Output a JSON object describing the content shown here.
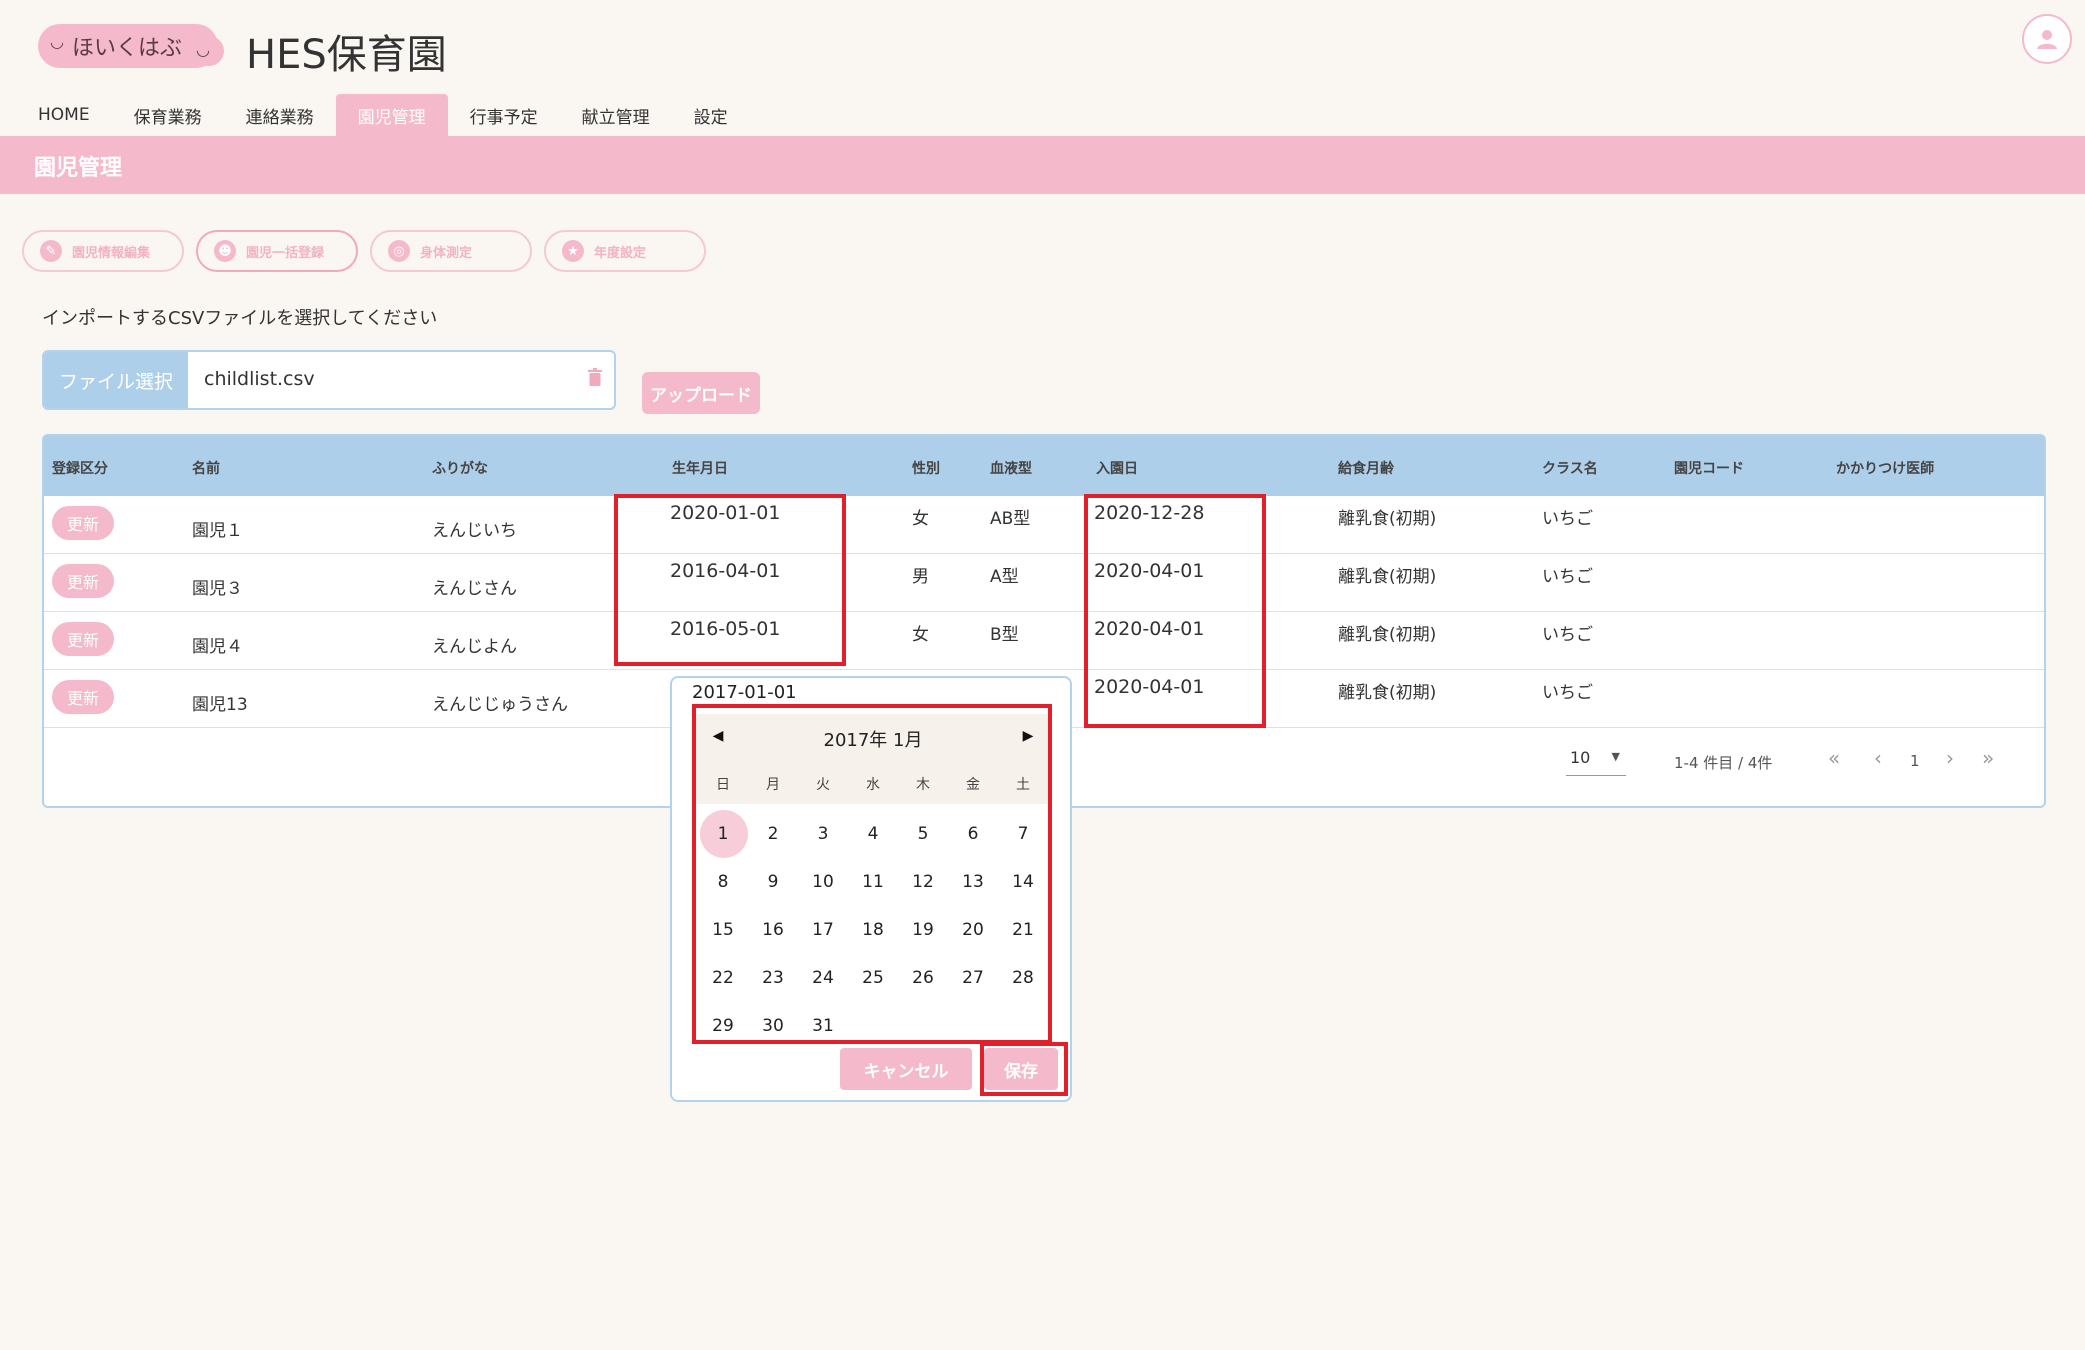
{
  "header": {
    "logo_text": "ほいくはぶ",
    "site_title": "HES保育園"
  },
  "nav": {
    "items": [
      {
        "label": "HOME"
      },
      {
        "label": "保育業務"
      },
      {
        "label": "連絡業務"
      },
      {
        "label": "園児管理"
      },
      {
        "label": "行事予定"
      },
      {
        "label": "献立管理"
      },
      {
        "label": "設定"
      }
    ],
    "active": "園児管理"
  },
  "section_title": "園児管理",
  "actions": [
    {
      "label": "園児情報編集",
      "icon": "edit-icon"
    },
    {
      "label": "園児一括登録",
      "icon": "group-icon"
    },
    {
      "label": "身体測定",
      "icon": "measure-icon"
    },
    {
      "label": "年度設定",
      "icon": "star-icon"
    }
  ],
  "import": {
    "label": "インポートするCSVファイルを選択してください",
    "file_button": "ファイル選択",
    "file_name": "childlist.csv",
    "upload_button": "アップロード"
  },
  "table": {
    "headers": [
      "登録区分",
      "名前",
      "ふりがな",
      "生年月日",
      "性別",
      "血液型",
      "入園日",
      "給食月齢",
      "クラス名",
      "園児コード",
      "かかりつけ医師"
    ],
    "rows": [
      {
        "status": "更新",
        "name": "園児１",
        "kana": "えんじいち",
        "birth": "2020-01-01",
        "sex": "女",
        "blood": "AB型",
        "entry": "2020-12-28",
        "meal": "離乳食(初期)",
        "class": "いちご"
      },
      {
        "status": "更新",
        "name": "園児３",
        "kana": "えんじさん",
        "birth": "2016-04-01",
        "sex": "男",
        "blood": "A型",
        "entry": "2020-04-01",
        "meal": "離乳食(初期)",
        "class": "いちご"
      },
      {
        "status": "更新",
        "name": "園児４",
        "kana": "えんじよん",
        "birth": "2016-05-01",
        "sex": "女",
        "blood": "B型",
        "entry": "2020-04-01",
        "meal": "離乳食(初期)",
        "class": "いちご"
      },
      {
        "status": "更新",
        "name": "園児13",
        "kana": "えんじじゅうさん",
        "birth": "",
        "sex": "",
        "blood": "",
        "entry": "2020-04-01",
        "meal": "離乳食(初期)",
        "class": "いちご"
      }
    ],
    "pager": {
      "per_page": "10",
      "range": "1-4 件目 / 4件",
      "page": "1"
    }
  },
  "datepicker": {
    "value": "2017-01-01",
    "month_title": "2017年 1月",
    "weekdays": [
      "日",
      "月",
      "火",
      "水",
      "木",
      "金",
      "土"
    ],
    "selected_day": "1",
    "cancel": "キャンセル",
    "save": "保存"
  },
  "colors": {
    "accent_pink": "#f4b9cb",
    "header_blue": "#aecfea",
    "annotation_red": "#e0202a"
  }
}
